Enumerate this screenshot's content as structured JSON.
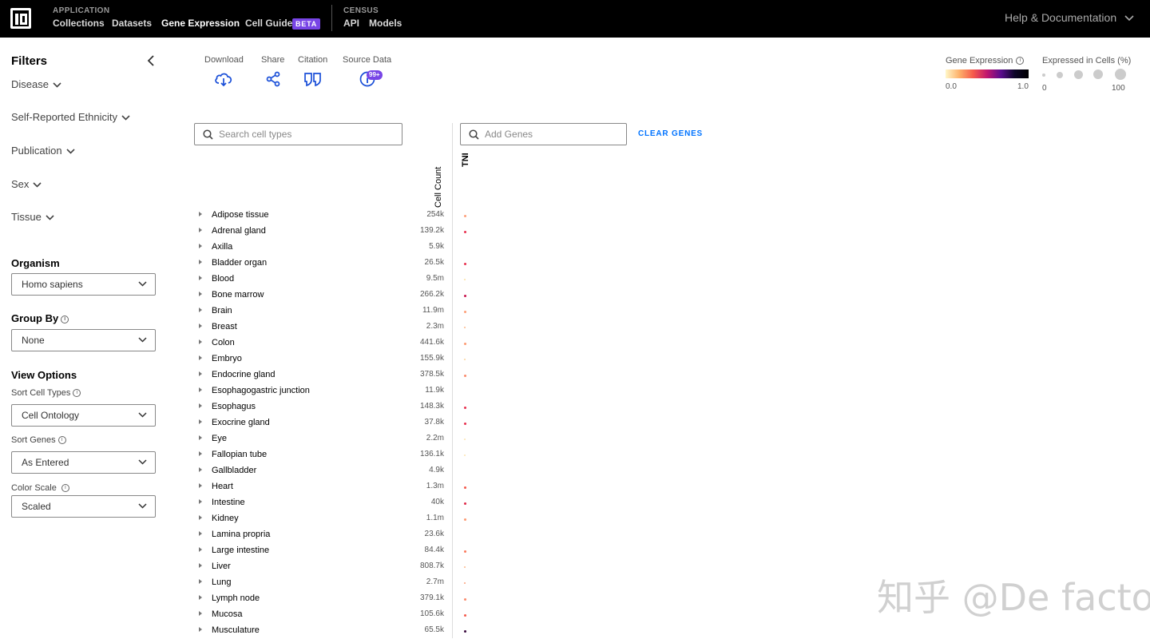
{
  "header": {
    "app_eyebrow": "APPLICATION",
    "app_links": [
      "Collections",
      "Datasets",
      "Gene Expression",
      "Cell Guide"
    ],
    "beta": "BETA",
    "census_eyebrow": "CENSUS",
    "census_links": [
      "API",
      "Models"
    ],
    "help": "Help & Documentation"
  },
  "sidebar": {
    "title": "Filters",
    "facets": [
      "Disease",
      "Self-Reported Ethnicity",
      "Publication",
      "Sex",
      "Tissue"
    ],
    "organism": {
      "label": "Organism",
      "value": "Homo sapiens"
    },
    "group_by": {
      "label": "Group By",
      "value": "None"
    },
    "view_options": "View Options",
    "sort_cell_types": {
      "label": "Sort Cell Types",
      "value": "Cell Ontology"
    },
    "sort_genes": {
      "label": "Sort Genes",
      "value": "As Entered"
    },
    "color_scale": {
      "label": "Color Scale",
      "value": "Scaled"
    }
  },
  "toolbar": {
    "download": "Download",
    "share": "Share",
    "citation": "Citation",
    "source_data": "Source Data",
    "source_badge": "99+"
  },
  "legend": {
    "gene_expression": "Gene Expression",
    "ge_min": "0.0",
    "ge_max": "1.0",
    "expressed": "Expressed in Cells (%)",
    "ex_min": "0",
    "ex_max": "100"
  },
  "search": {
    "cell_placeholder": "Search cell types",
    "gene_placeholder": "Add Genes",
    "clear": "CLEAR GENES"
  },
  "grid": {
    "cell_count_header": "Cell Count",
    "gene": "TNI",
    "rows": [
      {
        "name": "Adipose tissue",
        "count": "254k",
        "color": "#fda07a",
        "size": 3
      },
      {
        "name": "Adrenal gland",
        "count": "139.2k",
        "color": "#e8304f",
        "size": 3
      },
      {
        "name": "Axilla",
        "count": "5.9k",
        "color": "",
        "size": 0
      },
      {
        "name": "Bladder organ",
        "count": "26.5k",
        "color": "#e8304f",
        "size": 3
      },
      {
        "name": "Blood",
        "count": "9.5m",
        "color": "#fde0a0",
        "size": 2
      },
      {
        "name": "Bone marrow",
        "count": "266.2k",
        "color": "#c8154e",
        "size": 3
      },
      {
        "name": "Brain",
        "count": "11.9m",
        "color": "#fd9f78",
        "size": 3
      },
      {
        "name": "Breast",
        "count": "2.3m",
        "color": "#fdb88a",
        "size": 2
      },
      {
        "name": "Colon",
        "count": "441.6k",
        "color": "#fd9a72",
        "size": 3
      },
      {
        "name": "Embryo",
        "count": "155.9k",
        "color": "#fdd49a",
        "size": 2
      },
      {
        "name": "Endocrine gland",
        "count": "378.5k",
        "color": "#fb8a6c",
        "size": 3
      },
      {
        "name": "Esophagogastric junction",
        "count": "11.9k",
        "color": "",
        "size": 0
      },
      {
        "name": "Esophagus",
        "count": "148.3k",
        "color": "#e8304f",
        "size": 3
      },
      {
        "name": "Exocrine gland",
        "count": "37.8k",
        "color": "#e8304f",
        "size": 3
      },
      {
        "name": "Eye",
        "count": "2.2m",
        "color": "#fde3b0",
        "size": 2
      },
      {
        "name": "Fallopian tube",
        "count": "136.1k",
        "color": "#fde3b0",
        "size": 2
      },
      {
        "name": "Gallbladder",
        "count": "4.9k",
        "color": "",
        "size": 0
      },
      {
        "name": "Heart",
        "count": "1.3m",
        "color": "#f55a4c",
        "size": 3
      },
      {
        "name": "Intestine",
        "count": "40k",
        "color": "#e02a4a",
        "size": 3
      },
      {
        "name": "Kidney",
        "count": "1.1m",
        "color": "#fd9a72",
        "size": 3
      },
      {
        "name": "Lamina propria",
        "count": "23.6k",
        "color": "",
        "size": 0
      },
      {
        "name": "Large intestine",
        "count": "84.4k",
        "color": "#fb7a5e",
        "size": 3
      },
      {
        "name": "Liver",
        "count": "808.7k",
        "color": "#fdb88a",
        "size": 2
      },
      {
        "name": "Lung",
        "count": "2.7m",
        "color": "#fda07a",
        "size": 2
      },
      {
        "name": "Lymph node",
        "count": "379.1k",
        "color": "#fb8a6c",
        "size": 3
      },
      {
        "name": "Mucosa",
        "count": "105.6k",
        "color": "#f55a4c",
        "size": 3
      },
      {
        "name": "Musculature",
        "count": "65.5k",
        "color": "#3a0a3e",
        "size": 3
      }
    ]
  },
  "watermark": "知乎 @De facto"
}
